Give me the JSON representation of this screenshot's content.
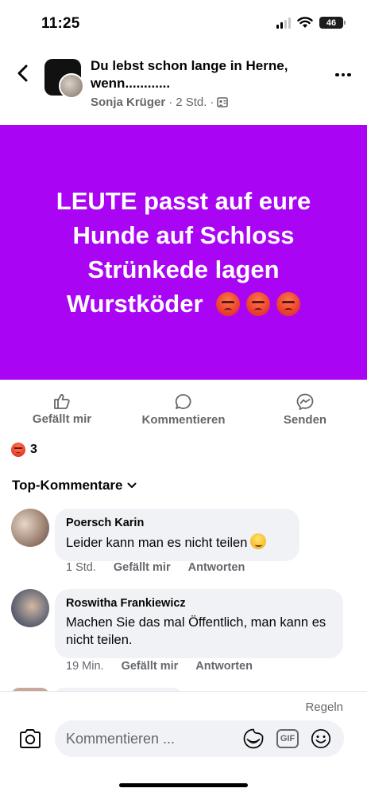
{
  "status_bar": {
    "time": "11:25",
    "battery": "46"
  },
  "header": {
    "group_name": "Du lebst schon lange in Herne, wenn............",
    "author": "Sonja Krüger",
    "separator": "·",
    "time_ago": "2 Std.",
    "icons": [
      "back-icon",
      "more-icon",
      "group-privacy-icon"
    ]
  },
  "post": {
    "background_color": "#a905f4",
    "image_text": "LEUTE passt auf eure Hunde auf Schloss Strünkede lagen Wurstköder"
  },
  "actions": {
    "like_label": "Gefällt mir",
    "comment_label": "Kommentieren",
    "share_label": "Senden"
  },
  "reactions": {
    "type": "angry",
    "count": "3"
  },
  "comments_section": {
    "sort_label": "Top-Kommentare",
    "comments": [
      {
        "name": "Poersch Karin",
        "text": "Leider kann man es nicht teilen",
        "time": "1 Std.",
        "like": "Gefällt mir",
        "reply": "Antworten"
      },
      {
        "name": "Roswitha Frankiewicz",
        "text": "Machen Sie das mal Öffentlich, man kann es nicht teilen.",
        "time": "19 Min.",
        "like": "Gefällt mir",
        "reply": "Antworten"
      }
    ]
  },
  "composer": {
    "rules_label": "Regeln",
    "placeholder": "Kommentieren ...",
    "gif_label": "GIF"
  },
  "colors": {
    "accent_text": "#65676b",
    "bubble": "#f0f2f5"
  }
}
